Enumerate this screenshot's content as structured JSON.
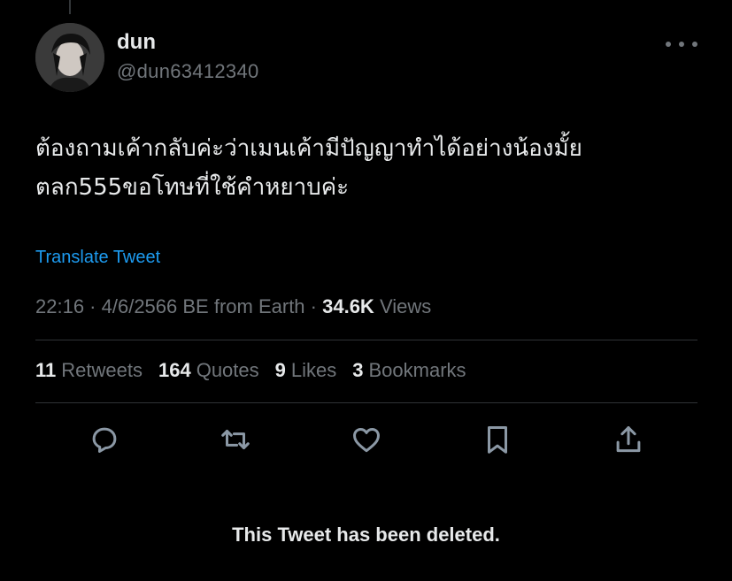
{
  "tweet": {
    "author": {
      "name": "dun",
      "handle": "@dun63412340"
    },
    "text_lines": [
      "ต้องถามเค้ากลับค่ะว่าเมนเค้ามีปัญญาทำได้อย่างน้องมั้ย",
      "ตลก555ขอโทษที่ใช้คำหยาบค่ะ"
    ],
    "translate_label": "Translate Tweet",
    "meta": {
      "time": "22:16",
      "sep1": " · ",
      "date": "4/6/2566 BE",
      "source": " from Earth",
      "sep2": " · ",
      "views_count": "34.6K",
      "views_label": " Views"
    },
    "stats": [
      {
        "count": "11",
        "label": "Retweets"
      },
      {
        "count": "164",
        "label": "Quotes"
      },
      {
        "count": "9",
        "label": "Likes"
      },
      {
        "count": "3",
        "label": "Bookmarks"
      }
    ],
    "actions": [
      "reply",
      "retweet",
      "like",
      "bookmark",
      "share"
    ]
  },
  "quoted_notice": "This Tweet has been deleted.",
  "colors": {
    "background": "#000000",
    "text": "#e7e9ea",
    "secondary": "#71767b",
    "accent": "#1d9bf0",
    "divider": "#2f3336"
  }
}
